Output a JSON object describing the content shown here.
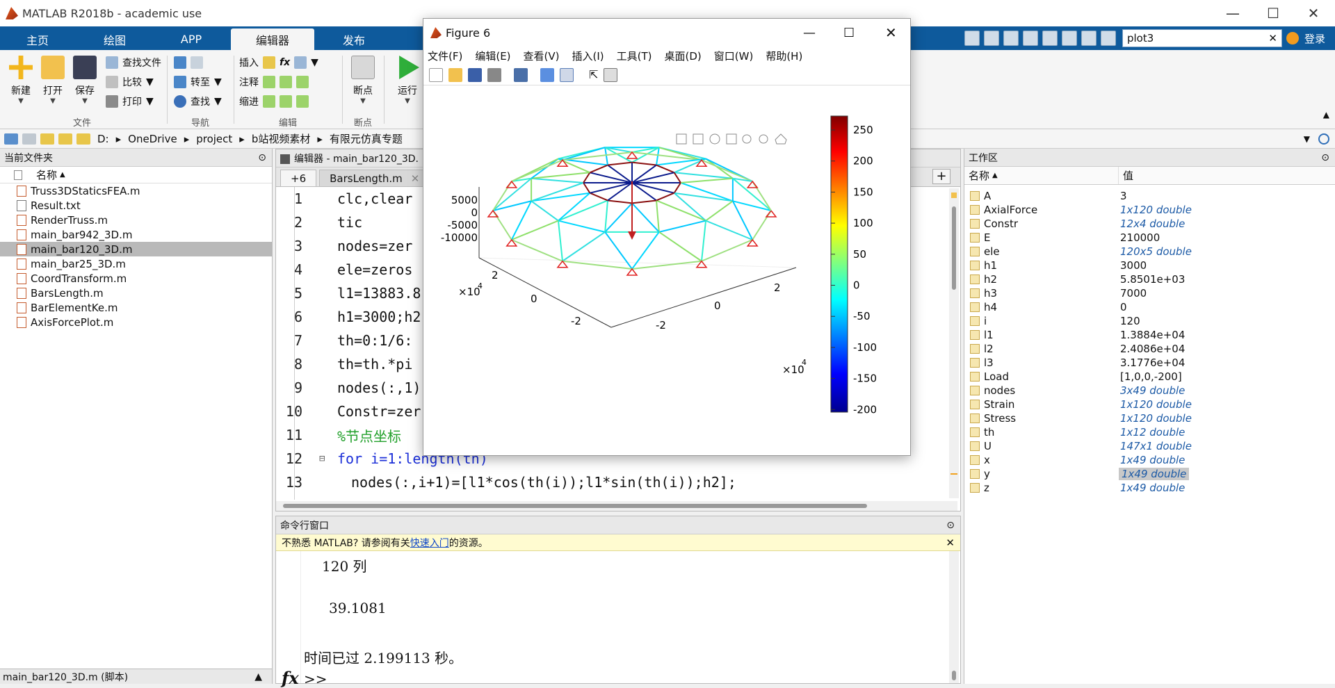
{
  "app": {
    "title": "MATLAB R2018b - academic use"
  },
  "tabs": [
    "主页",
    "绘图",
    "APP",
    "编辑器",
    "发布"
  ],
  "active_tab": "编辑器",
  "quick_search": {
    "value": "plot3"
  },
  "login_label": "登录",
  "ribbon": {
    "new": "新建",
    "open": "打开",
    "save": "保存",
    "find_files": "查找文件",
    "compare": "比较",
    "print": "打印",
    "goto": "转至",
    "find": "查找",
    "insert": "插入",
    "comment": "注释",
    "indent": "缩进",
    "breakpoints": "断点",
    "run": "运行",
    "groups": {
      "file": "文件",
      "nav": "导航",
      "edit": "编辑",
      "bp": "断点"
    }
  },
  "address": [
    "D:",
    "OneDrive",
    "project",
    "b站视频素材",
    "有限元仿真专题"
  ],
  "file_panel": {
    "title": "当前文件夹",
    "col_name": "名称",
    "files": [
      "Truss3DStaticsFEA.m",
      "Result.txt",
      "RenderTruss.m",
      "main_bar942_3D.m",
      "main_bar120_3D.m",
      "main_bar25_3D.m",
      "CoordTransform.m",
      "BarsLength.m",
      "BarElementKe.m",
      "AxisForcePlot.m"
    ],
    "selected": "main_bar120_3D.m",
    "footer": "main_bar120_3D.m (脚本)"
  },
  "editor": {
    "title": "编辑器 - main_bar120_3D.",
    "tab_count": "+6",
    "tab": "BarsLength.m",
    "lines": [
      {
        "n": "1",
        "code": "clc,clear"
      },
      {
        "n": "2",
        "code": "tic"
      },
      {
        "n": "3",
        "code": "nodes=zer"
      },
      {
        "n": "4",
        "code": "ele=zeros"
      },
      {
        "n": "5",
        "code": "l1=13883.8"
      },
      {
        "n": "6",
        "code": "h1=3000;h2"
      },
      {
        "n": "7",
        "code": "th=0:1/6:"
      },
      {
        "n": "8",
        "code": "th=th.*pi"
      },
      {
        "n": "9",
        "code": "nodes(:,1)"
      },
      {
        "n": "10",
        "code": "Constr=zer"
      },
      {
        "n": "11",
        "code": "%节点坐标"
      },
      {
        "n": "12",
        "code": "for i=1:length(th)"
      },
      {
        "n": "13",
        "code": "nodes(:,i+1)=[l1*cos(th(i));l1*sin(th(i));h2];"
      }
    ]
  },
  "cmd": {
    "title": "命令行窗口",
    "notice_pre": "不熟悉 MATLAB? 请参阅有关",
    "notice_link": "快速入门",
    "notice_post": "的资源。",
    "out1": "120 列",
    "out2": "39.1081",
    "out3": "时间已过 2.199113 秒。",
    "prompt": ">>",
    "fx": "fx"
  },
  "workspace": {
    "title": "工作区",
    "col_name": "名称",
    "col_value": "值",
    "rows": [
      {
        "name": "A",
        "value": "3",
        "italic": false
      },
      {
        "name": "AxialForce",
        "value": "1x120 double",
        "italic": true
      },
      {
        "name": "Constr",
        "value": "12x4 double",
        "italic": true
      },
      {
        "name": "E",
        "value": "210000",
        "italic": false
      },
      {
        "name": "ele",
        "value": "120x5 double",
        "italic": true
      },
      {
        "name": "h1",
        "value": "3000",
        "italic": false
      },
      {
        "name": "h2",
        "value": "5.8501e+03",
        "italic": false
      },
      {
        "name": "h3",
        "value": "7000",
        "italic": false
      },
      {
        "name": "h4",
        "value": "0",
        "italic": false
      },
      {
        "name": "i",
        "value": "120",
        "italic": false
      },
      {
        "name": "l1",
        "value": "1.3884e+04",
        "italic": false
      },
      {
        "name": "l2",
        "value": "2.4086e+04",
        "italic": false
      },
      {
        "name": "l3",
        "value": "3.1776e+04",
        "italic": false
      },
      {
        "name": "Load",
        "value": "[1,0,0,-200]",
        "italic": false
      },
      {
        "name": "nodes",
        "value": "3x49 double",
        "italic": true
      },
      {
        "name": "Strain",
        "value": "1x120 double",
        "italic": true
      },
      {
        "name": "Stress",
        "value": "1x120 double",
        "italic": true
      },
      {
        "name": "th",
        "value": "1x12 double",
        "italic": true
      },
      {
        "name": "U",
        "value": "147x1 double",
        "italic": true
      },
      {
        "name": "x",
        "value": "1x49 double",
        "italic": true
      },
      {
        "name": "y",
        "value": "1x49 double",
        "italic": true
      },
      {
        "name": "z",
        "value": "1x49 double",
        "italic": true
      }
    ],
    "highlighted": "y"
  },
  "figure": {
    "title": "Figure 6",
    "menu": [
      "文件(F)",
      "编辑(E)",
      "查看(V)",
      "插入(I)",
      "工具(T)",
      "桌面(D)",
      "窗口(W)",
      "帮助(H)"
    ],
    "z_ticks": [
      "5000",
      "0",
      "-5000",
      "-10000"
    ],
    "y_ticks": [
      "2",
      "0",
      "-2"
    ],
    "x_ticks": [
      "2",
      "0",
      "-2"
    ],
    "exp_label": "×10",
    "exp_power": "4",
    "colorbar_ticks": [
      "250",
      "200",
      "150",
      "100",
      "50",
      "0",
      "-50",
      "-100",
      "-150",
      "-200"
    ]
  }
}
